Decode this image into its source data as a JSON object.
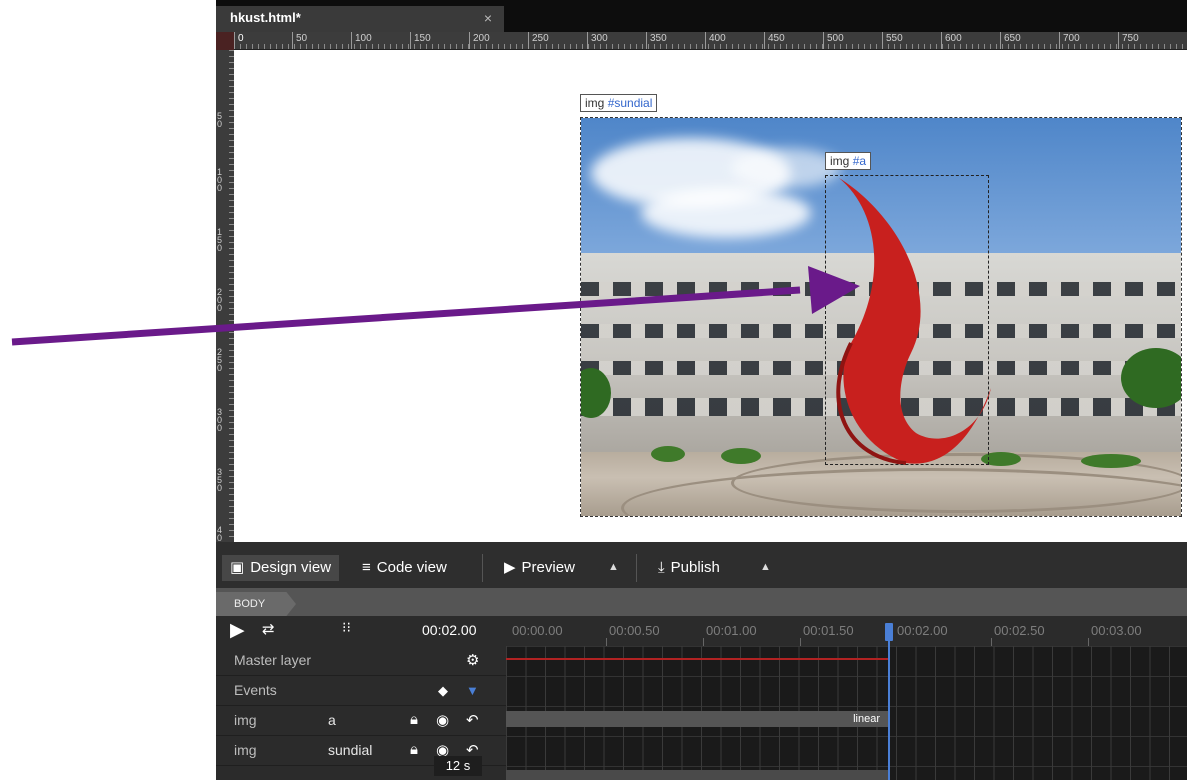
{
  "tab": {
    "title": "hkust.html*",
    "close": "×"
  },
  "ruler": {
    "h_labels": [
      "0",
      "50",
      "100",
      "150",
      "200",
      "250",
      "300",
      "350",
      "400",
      "450",
      "500",
      "550",
      "600",
      "650",
      "700",
      "750"
    ],
    "v_labels": [
      "5\n0",
      "1\n0\n0",
      "1\n5\n0",
      "2\n0\n0",
      "2\n5\n0",
      "3\n0\n0",
      "3\n5\n0",
      "4\n0"
    ]
  },
  "canvas": {
    "sundial_label": {
      "tag": "img",
      "id": "#sundial"
    },
    "a_label": {
      "tag": "img",
      "id": "#a"
    }
  },
  "viewbar": {
    "design": "Design view",
    "code": "Code view",
    "preview": "Preview",
    "publish": "Publish"
  },
  "breadcrumb": "BODY",
  "timeline": {
    "current_time": "00:02.00",
    "times": [
      "00:00.00",
      "00:00.50",
      "00:01.00",
      "00:01.50",
      "00:02.00",
      "00:02.50",
      "00:03.00"
    ],
    "rows": [
      {
        "c1": "Master layer",
        "c2": ""
      },
      {
        "c1": "Events",
        "c2": ""
      },
      {
        "c1": "img",
        "c2": "a"
      },
      {
        "c1": "img",
        "c2": "sundial"
      }
    ],
    "easing": "linear",
    "duration": "12 s"
  },
  "colors": {
    "accent": "#4a7fd6",
    "arrow": "#6a1a8a",
    "master_line": "#b22222"
  },
  "icons": [
    "play-icon",
    "loop-icon",
    "keyframe-options-icon",
    "gear-icon",
    "diamond-icon",
    "filter-triangle-icon",
    "lock-icon",
    "eye-icon",
    "undo-icon",
    "design-view-icon",
    "code-view-icon",
    "preview-icon",
    "publish-icon"
  ]
}
